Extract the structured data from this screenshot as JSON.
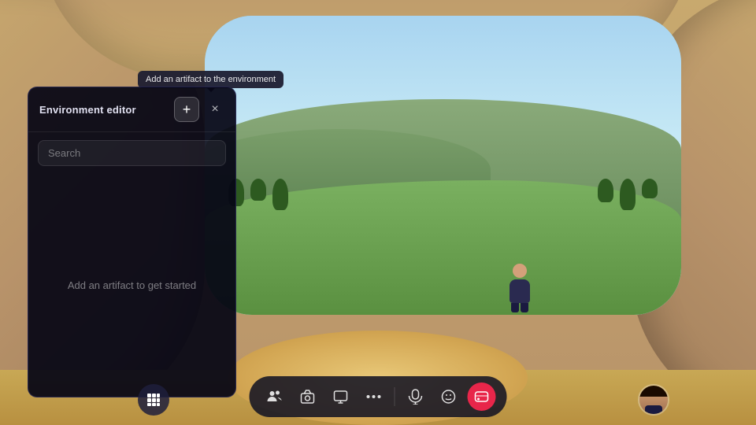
{
  "environment": {
    "bg_color": "#c8a96e"
  },
  "tooltip": {
    "text": "Add an artifact to the environment"
  },
  "panel": {
    "title": "Environment editor",
    "search_placeholder": "Search",
    "empty_message": "Add an artifact to get started",
    "add_button_label": "+",
    "close_button_label": "×"
  },
  "toolbar": {
    "buttons": [
      {
        "id": "people",
        "label": "👥",
        "aria": "people-button"
      },
      {
        "id": "camera",
        "label": "📷",
        "aria": "camera-button"
      },
      {
        "id": "screen",
        "label": "🖥",
        "aria": "screen-share-button"
      },
      {
        "id": "more",
        "label": "•••",
        "aria": "more-button"
      },
      {
        "id": "mic",
        "label": "🎤",
        "aria": "mic-button"
      },
      {
        "id": "emoji",
        "label": "😊",
        "aria": "emoji-button"
      },
      {
        "id": "view",
        "label": "⊡",
        "aria": "view-button",
        "active": true
      }
    ]
  },
  "left_btn": {
    "label": "⠿",
    "aria": "grid-menu-button"
  },
  "colors": {
    "panel_bg": "rgba(5,5,20,0.93)",
    "toolbar_bg": "rgba(20,20,35,0.88)",
    "active_red": "#e8264a",
    "accent_blue": "rgba(100,100,200,0.3)"
  }
}
